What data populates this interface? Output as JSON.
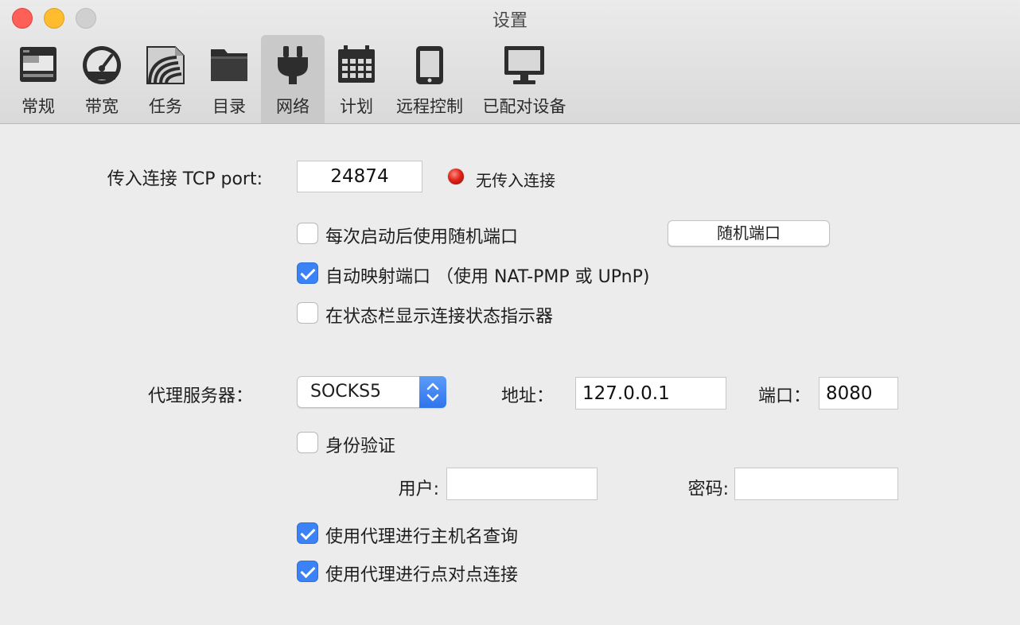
{
  "window": {
    "title": "设置"
  },
  "toolbar": {
    "tabs": [
      {
        "label": "常规",
        "icon": "general-icon"
      },
      {
        "label": "带宽",
        "icon": "bandwidth-gauge-icon"
      },
      {
        "label": "任务",
        "icon": "transfers-icon"
      },
      {
        "label": "目录",
        "icon": "folder-icon"
      },
      {
        "label": "网络",
        "icon": "network-plug-icon",
        "selected": true
      },
      {
        "label": "计划",
        "icon": "calendar-icon"
      },
      {
        "label": "远程控制",
        "icon": "remote-device-icon"
      },
      {
        "label": "已配对设备",
        "icon": "monitor-icon"
      }
    ]
  },
  "incoming": {
    "label": "传入连接 TCP port:",
    "port": "24874",
    "status_text": "无传入连接",
    "status_color": "#e0241a"
  },
  "options": {
    "random_port_on_launch": {
      "label": "每次启动后使用随机端口",
      "checked": false
    },
    "random_port_button": "随机端口",
    "auto_map_port": {
      "label": "自动映射端口 （使用 NAT-PMP 或 UPnP)",
      "checked": true
    },
    "status_bar_indicator": {
      "label": "在状态栏显示连接状态指示器",
      "checked": false
    }
  },
  "proxy": {
    "label": "代理服务器：",
    "type": "SOCKS5",
    "address_label": "地址：",
    "address": "127.0.0.1",
    "port_label": "端口：",
    "port": "8080",
    "auth": {
      "label": "身份验证",
      "checked": false
    },
    "user_label": "用户:",
    "user": "",
    "password_label": "密码:",
    "password": "",
    "hostname_lookup": {
      "label": "使用代理进行主机名查询",
      "checked": true
    },
    "peer_connections": {
      "label": "使用代理进行点对点连接",
      "checked": true
    }
  },
  "colors": {
    "accent": "#3a82f6",
    "background": "#ececec"
  }
}
